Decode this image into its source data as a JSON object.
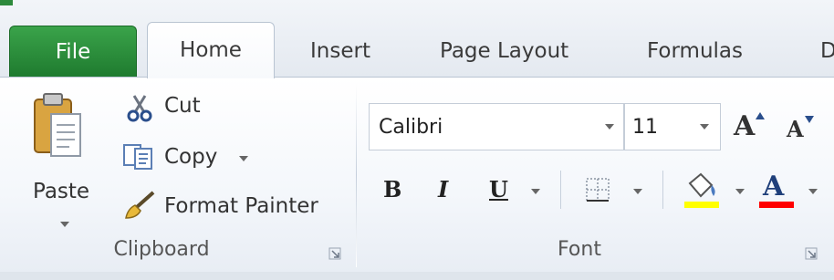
{
  "tabs": {
    "file": "File",
    "home": "Home",
    "insert": "Insert",
    "page_layout": "Page Layout",
    "formulas": "Formulas",
    "partial": "D"
  },
  "clipboard": {
    "paste": "Paste",
    "cut": "Cut",
    "copy": "Copy",
    "format_painter": "Format Painter",
    "group_label": "Clipboard"
  },
  "font": {
    "font_name": "Calibri",
    "font_size": "11",
    "bold": "B",
    "italic": "I",
    "underline": "U",
    "font_color_glyph": "A",
    "grow_glyph": "A",
    "shrink_glyph": "A",
    "group_label": "Font",
    "highlight_color": "#ffff00",
    "font_color": "#ff0000"
  },
  "icons": {
    "paste": "paste-clipboard-icon",
    "cut": "scissors-icon",
    "copy": "copy-pages-icon",
    "format_painter": "paintbrush-icon",
    "borders": "borders-icon",
    "fill": "paint-bucket-icon",
    "dialog_launcher": "dialog-launcher-icon"
  }
}
